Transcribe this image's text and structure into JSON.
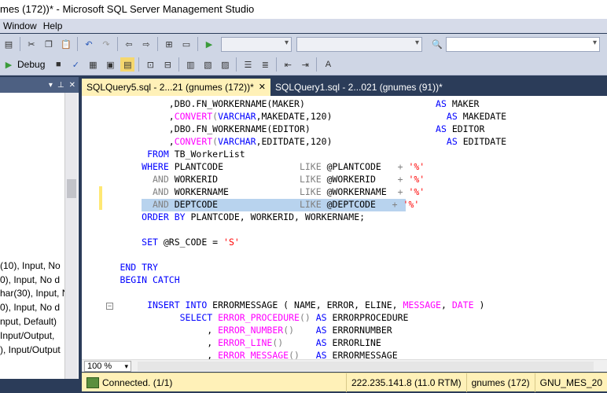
{
  "window": {
    "title": "mes (172))* - Microsoft SQL Server Management Studio"
  },
  "menu": [
    "Window",
    "Help"
  ],
  "toolbar2": {
    "debug_label": "Debug"
  },
  "left_pane": {
    "lines": [
      "(10), Input, No",
      "0), Input, No d",
      "har(30), Input, N",
      "0), Input, No d",
      "nput, Default)",
      "Input/Output,",
      "), Input/Output"
    ]
  },
  "tabs": [
    {
      "label": "SQLQuery5.sql - 2...21 (gnumes (172))*",
      "close": "✕"
    },
    {
      "label": "SQLQuery1.sql - 2...021 (gnumes (91))*"
    }
  ],
  "code_lines": [
    [
      [
        "bk",
        "                ,DBO.FN_WORKERNAME(MAKER)                        "
      ],
      [
        "kw",
        "AS"
      ],
      [
        "bk",
        " MAKER"
      ]
    ],
    [
      [
        "bk",
        "                ,"
      ],
      [
        "fn",
        "CONVERT"
      ],
      [
        "gr",
        "("
      ],
      [
        "kw",
        "VARCHAR"
      ],
      [
        "bk",
        ",MAKEDATE,120)                     "
      ],
      [
        "kw",
        "AS"
      ],
      [
        "bk",
        " MAKEDATE"
      ]
    ],
    [
      [
        "bk",
        "                ,DBO.FN_WORKERNAME(EDITOR)                       "
      ],
      [
        "kw",
        "AS"
      ],
      [
        "bk",
        " EDITOR"
      ]
    ],
    [
      [
        "bk",
        "                ,"
      ],
      [
        "fn",
        "CONVERT"
      ],
      [
        "gr",
        "("
      ],
      [
        "kw",
        "VARCHAR"
      ],
      [
        "bk",
        ",EDITDATE,120)                     "
      ],
      [
        "kw",
        "AS"
      ],
      [
        "bk",
        " EDITDATE"
      ]
    ],
    [
      [
        "kw",
        "            FROM"
      ],
      [
        "bk",
        " TB_WorkerList"
      ]
    ],
    [
      [
        "kw",
        "           WHERE"
      ],
      [
        "bk",
        " PLANTCODE              "
      ],
      [
        "gr",
        "LIKE"
      ],
      [
        "bk",
        " @PLANTCODE   "
      ],
      [
        "gr",
        "+"
      ],
      [
        "st",
        " '%'"
      ]
    ],
    [
      [
        "gr",
        "             AND"
      ],
      [
        "bk",
        " WORKERID               "
      ],
      [
        "gr",
        "LIKE"
      ],
      [
        "bk",
        " @WORKERID    "
      ],
      [
        "gr",
        "+"
      ],
      [
        "st",
        " '%'"
      ]
    ],
    [
      [
        "gr",
        "             AND"
      ],
      [
        "bk",
        " WORKERNAME             "
      ],
      [
        "gr",
        "LIKE"
      ],
      [
        "bk",
        " @WORKERNAME  "
      ],
      [
        "gr",
        "+"
      ],
      [
        "st",
        " '%'"
      ]
    ],
    [
      [
        "gr",
        "             AND"
      ],
      [
        "bk",
        " DEPTCODE               "
      ],
      [
        "gr",
        "LIKE"
      ],
      [
        "bk",
        " @DEPTCODE   "
      ],
      [
        "gr",
        "+"
      ],
      [
        "st",
        " '%'"
      ]
    ],
    [
      [
        "kw",
        "           ORDER BY"
      ],
      [
        "bk",
        " PLANTCODE, WORKERID, WORKERNAME;"
      ]
    ],
    [
      [
        "bk",
        ""
      ]
    ],
    [
      [
        "kw",
        "           SET"
      ],
      [
        "bk",
        " @RS_CODE = "
      ],
      [
        "st",
        "'S'"
      ]
    ],
    [
      [
        "bk",
        ""
      ]
    ],
    [
      [
        "kw",
        "       END TRY"
      ]
    ],
    [
      [
        "kw",
        "       BEGIN CATCH"
      ]
    ],
    [
      [
        "bk",
        ""
      ]
    ],
    [
      [
        "kw",
        "            INSERT INTO"
      ],
      [
        "bk",
        " ERRORMESSAGE ( NAME, ERROR, ELINE, "
      ],
      [
        "fn",
        "MESSAGE"
      ],
      [
        "bk",
        ", "
      ],
      [
        "fn",
        "DATE"
      ],
      [
        "bk",
        " )"
      ]
    ],
    [
      [
        "kw",
        "                  SELECT"
      ],
      [
        "bk",
        " "
      ],
      [
        "fn",
        "ERROR_PROCEDURE"
      ],
      [
        "gr",
        "()"
      ],
      [
        "kw",
        " AS"
      ],
      [
        "bk",
        " ERRORPROCEDURE"
      ]
    ],
    [
      [
        "bk",
        "                       , "
      ],
      [
        "fn",
        "ERROR_NUMBER"
      ],
      [
        "gr",
        "()"
      ],
      [
        "bk",
        "    "
      ],
      [
        "kw",
        "AS"
      ],
      [
        "bk",
        " ERRORNUMBER"
      ]
    ],
    [
      [
        "bk",
        "                       , "
      ],
      [
        "fn",
        "ERROR_LINE"
      ],
      [
        "gr",
        "()"
      ],
      [
        "bk",
        "      "
      ],
      [
        "kw",
        "AS"
      ],
      [
        "bk",
        " ERRORLINE"
      ]
    ],
    [
      [
        "bk",
        "                       , "
      ],
      [
        "fn",
        "ERROR_MESSAGE"
      ],
      [
        "gr",
        "()"
      ],
      [
        "bk",
        "   "
      ],
      [
        "kw",
        "AS"
      ],
      [
        "bk",
        " ERRORMESSAGE"
      ]
    ]
  ],
  "zoom": "100 %",
  "status": {
    "connection": "Connected. (1/1)",
    "server": "222.235.141.8 (11.0 RTM)",
    "login": "gnumes (172)",
    "database": "GNU_MES_20"
  }
}
